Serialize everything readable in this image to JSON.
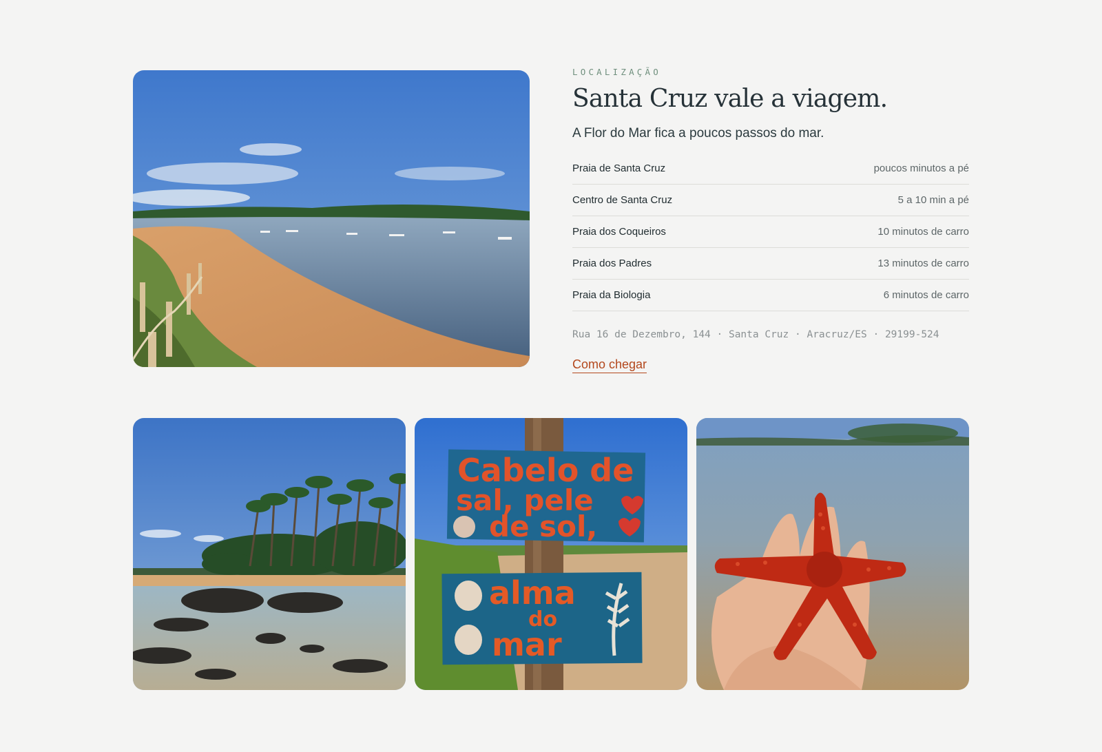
{
  "location": {
    "eyebrow": "LOCALIZAÇÃO",
    "title": "Santa Cruz vale a viagem.",
    "subtitle": "A Flor do Mar fica a poucos passos do mar.",
    "places": [
      {
        "name": "Praia de Santa Cruz",
        "time": "poucos minutos a pé"
      },
      {
        "name": "Centro de Santa Cruz",
        "time": "5 a 10 min a pé"
      },
      {
        "name": "Praia dos Coqueiros",
        "time": "10 minutos de carro"
      },
      {
        "name": "Praia dos Padres",
        "time": "13 minutos de carro"
      },
      {
        "name": "Praia da Biologia",
        "time": "6 minutos de carro"
      }
    ],
    "address": "Rua 16 de Dezembro, 144 · Santa Cruz · Aracruz/ES · 29199-524",
    "directions_label": "Como chegar"
  },
  "gallery": {
    "sign_line_1": "Cabelo de",
    "sign_line_2": "sal, pele",
    "sign_line_3": "de sol,",
    "sign2_line_1": "alma",
    "sign2_line_2": "do",
    "sign2_line_3": "mar"
  },
  "colors": {
    "background": "#f4f4f3",
    "accent": "#b3471c",
    "eyebrow": "#6f8f7d"
  }
}
